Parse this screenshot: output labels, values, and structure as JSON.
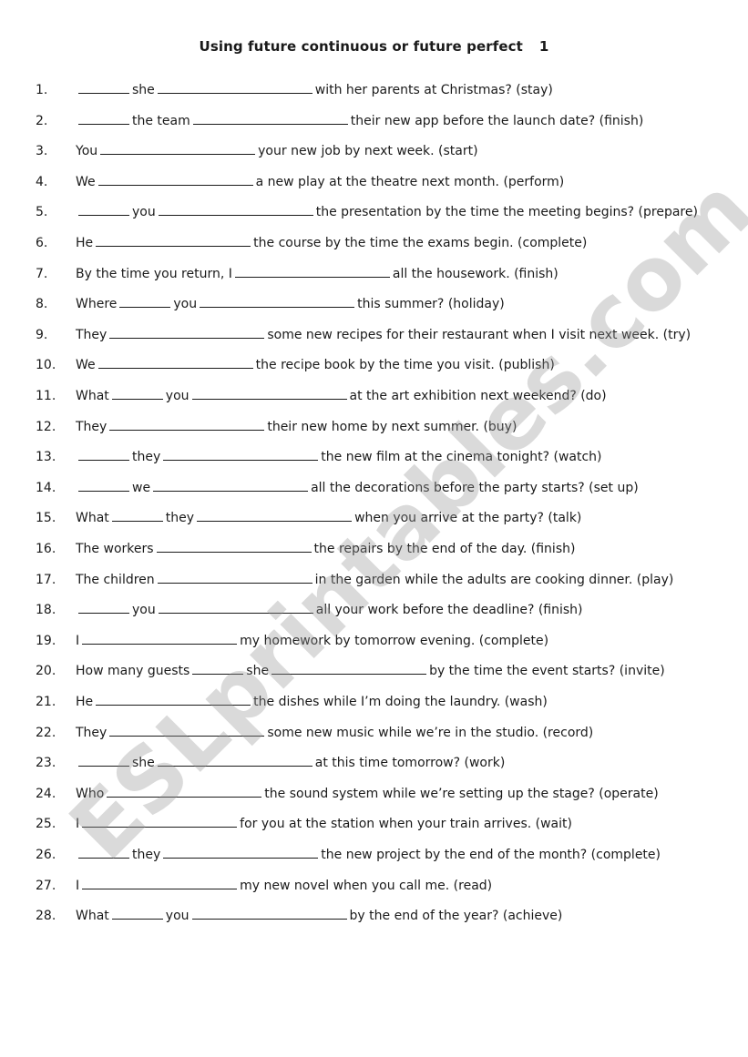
{
  "title": "Using future continuous or future perfect",
  "title_number": "1",
  "watermark": "ESLprintables.com",
  "items": [
    {
      "num": "1.",
      "parts": [
        {
          "b": "short"
        },
        {
          "t": "she"
        },
        {
          "b": "long"
        },
        {
          "t": "with her parents at Christmas? (stay)"
        }
      ]
    },
    {
      "num": "2.",
      "parts": [
        {
          "b": "short"
        },
        {
          "t": "the team"
        },
        {
          "b": "long"
        },
        {
          "t": "their new app before the launch date? (finish)"
        }
      ]
    },
    {
      "num": "3.",
      "parts": [
        {
          "t": "You"
        },
        {
          "b": "long"
        },
        {
          "t": "your new job by next week. (start)"
        }
      ]
    },
    {
      "num": "4.",
      "parts": [
        {
          "t": "We"
        },
        {
          "b": "long"
        },
        {
          "t": "a new play at the theatre next month. (perform)"
        }
      ]
    },
    {
      "num": "5.",
      "parts": [
        {
          "b": "short"
        },
        {
          "t": "you"
        },
        {
          "b": "long"
        },
        {
          "t": "the presentation by the time the meeting begins? (prepare)"
        }
      ]
    },
    {
      "num": "6.",
      "parts": [
        {
          "t": "He"
        },
        {
          "b": "long"
        },
        {
          "t": "the course by the time the exams begin. (complete)"
        }
      ]
    },
    {
      "num": "7.",
      "parts": [
        {
          "t": "By the time you return, I"
        },
        {
          "b": "long"
        },
        {
          "t": "all the housework. (finish)"
        }
      ]
    },
    {
      "num": "8.",
      "parts": [
        {
          "t": "Where"
        },
        {
          "b": "short"
        },
        {
          "t": "you"
        },
        {
          "b": "long"
        },
        {
          "t": "this summer? (holiday)"
        }
      ]
    },
    {
      "num": "9.",
      "parts": [
        {
          "t": "They"
        },
        {
          "b": "long"
        },
        {
          "t": "some new recipes for their restaurant when I visit next week. (try)"
        }
      ]
    },
    {
      "num": "10.",
      "parts": [
        {
          "t": "We"
        },
        {
          "b": "long"
        },
        {
          "t": "the recipe book by the time you visit. (publish)"
        }
      ]
    },
    {
      "num": "11.",
      "parts": [
        {
          "t": "What"
        },
        {
          "b": "short"
        },
        {
          "t": "you"
        },
        {
          "b": "long"
        },
        {
          "t": "at the art exhibition next weekend? (do)"
        }
      ]
    },
    {
      "num": "12.",
      "parts": [
        {
          "t": "They"
        },
        {
          "b": "long"
        },
        {
          "t": "their new home by next summer. (buy)"
        }
      ]
    },
    {
      "num": "13.",
      "parts": [
        {
          "b": "short"
        },
        {
          "t": "they"
        },
        {
          "b": "long"
        },
        {
          "t": "the new film at the cinema tonight? (watch)"
        }
      ]
    },
    {
      "num": "14.",
      "parts": [
        {
          "b": "short"
        },
        {
          "t": "we"
        },
        {
          "b": "long"
        },
        {
          "t": "all the decorations before the party starts? (set up)"
        }
      ]
    },
    {
      "num": "15.",
      "parts": [
        {
          "t": "What"
        },
        {
          "b": "short"
        },
        {
          "t": "they"
        },
        {
          "b": "long"
        },
        {
          "t": "when you arrive at the party? (talk)"
        }
      ]
    },
    {
      "num": "16.",
      "parts": [
        {
          "t": "The workers"
        },
        {
          "b": "long"
        },
        {
          "t": "the repairs by the end of the day. (finish)"
        }
      ]
    },
    {
      "num": "17.",
      "parts": [
        {
          "t": "The children"
        },
        {
          "b": "long"
        },
        {
          "t": "in the garden while the adults are cooking dinner. (play)"
        }
      ]
    },
    {
      "num": "18.",
      "parts": [
        {
          "b": "short"
        },
        {
          "t": "you"
        },
        {
          "b": "long"
        },
        {
          "t": "all your work before the deadline? (finish)"
        }
      ]
    },
    {
      "num": "19.",
      "parts": [
        {
          "t": "I"
        },
        {
          "b": "long"
        },
        {
          "t": "my homework by tomorrow evening. (complete)"
        }
      ]
    },
    {
      "num": "20.",
      "parts": [
        {
          "t": "How many guests"
        },
        {
          "b": "short"
        },
        {
          "t": "she"
        },
        {
          "b": "long"
        },
        {
          "t": "by the time the event starts? (invite)"
        }
      ]
    },
    {
      "num": "21.",
      "parts": [
        {
          "t": "He"
        },
        {
          "b": "long"
        },
        {
          "t": "the dishes while I’m doing the laundry. (wash)"
        }
      ]
    },
    {
      "num": "22.",
      "parts": [
        {
          "t": "They"
        },
        {
          "b": "long"
        },
        {
          "t": "some new music while we’re in the studio. (record)"
        }
      ]
    },
    {
      "num": "23.",
      "parts": [
        {
          "b": "short"
        },
        {
          "t": "she"
        },
        {
          "b": "long"
        },
        {
          "t": "at this time tomorrow? (work)"
        }
      ]
    },
    {
      "num": "24.",
      "parts": [
        {
          "t": "Who"
        },
        {
          "b": "long"
        },
        {
          "t": "the sound system while we’re setting up the stage? (operate)"
        }
      ]
    },
    {
      "num": "25.",
      "parts": [
        {
          "t": "I"
        },
        {
          "b": "long"
        },
        {
          "t": "for you at the station when your train arrives. (wait)"
        }
      ]
    },
    {
      "num": "26.",
      "parts": [
        {
          "b": "short"
        },
        {
          "t": "they"
        },
        {
          "b": "long"
        },
        {
          "t": "the new project by the end of the month? (complete)"
        }
      ]
    },
    {
      "num": "27.",
      "parts": [
        {
          "t": "I"
        },
        {
          "b": "long"
        },
        {
          "t": "my new novel when you call me. (read)"
        }
      ]
    },
    {
      "num": "28.",
      "parts": [
        {
          "t": "What"
        },
        {
          "b": "short"
        },
        {
          "t": "you"
        },
        {
          "b": "long"
        },
        {
          "t": "by the end of the year? (achieve)"
        }
      ]
    }
  ]
}
